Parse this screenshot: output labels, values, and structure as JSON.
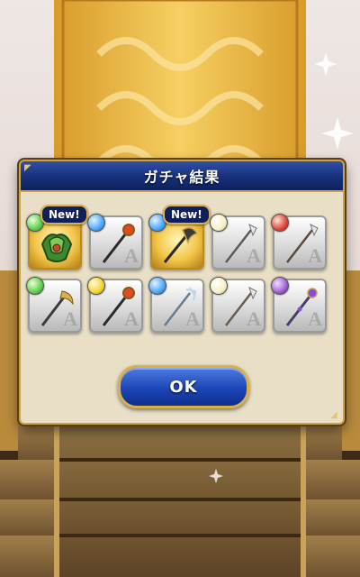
{
  "dialog": {
    "title": "ガチャ結果",
    "ok_label": "OK"
  },
  "items": [
    {
      "new_badge": "New!",
      "rank": "",
      "element": "wind",
      "orb_color": "#5fcf4a",
      "icon": "green-armor-icon",
      "highlight": true
    },
    {
      "new_badge": "",
      "rank": "A",
      "element": "water",
      "orb_color": "#4aa8ff",
      "icon": "red-gem-staff-icon",
      "highlight": false
    },
    {
      "new_badge": "New!",
      "rank": "",
      "element": "water",
      "orb_color": "#4aa8ff",
      "icon": "dark-axe-staff-icon",
      "highlight": true
    },
    {
      "new_badge": "",
      "rank": "A",
      "element": "light",
      "orb_color": "#f5f0c8",
      "icon": "silver-spear-icon",
      "highlight": false
    },
    {
      "new_badge": "",
      "rank": "A",
      "element": "fire",
      "orb_color": "#e0483a",
      "icon": "silver-spear-icon",
      "highlight": false
    },
    {
      "new_badge": "",
      "rank": "A",
      "element": "wind",
      "orb_color": "#5fcf4a",
      "icon": "gold-scythe-icon",
      "highlight": false
    },
    {
      "new_badge": "",
      "rank": "A",
      "element": "thunder",
      "orb_color": "#f3d530",
      "icon": "red-gem-staff-icon",
      "highlight": false
    },
    {
      "new_badge": "",
      "rank": "A",
      "element": "water",
      "orb_color": "#4aa8ff",
      "icon": "silver-trident-icon",
      "highlight": false
    },
    {
      "new_badge": "",
      "rank": "A",
      "element": "light",
      "orb_color": "#f5f0c8",
      "icon": "silver-spear-icon",
      "highlight": false
    },
    {
      "new_badge": "",
      "rank": "A",
      "element": "dark",
      "orb_color": "#a060d8",
      "icon": "purple-staff-icon",
      "highlight": false
    }
  ]
}
